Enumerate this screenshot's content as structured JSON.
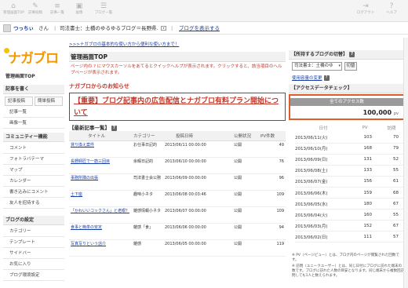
{
  "toolbar": {
    "items": [
      {
        "label": "管理画面TOP",
        "icon": "home-icon"
      },
      {
        "label": "記事投稿",
        "icon": "pencil-icon"
      },
      {
        "label": "記事一覧",
        "icon": "list-icon"
      },
      {
        "label": "画像",
        "icon": "image-icon"
      },
      {
        "label": "ブログー覧",
        "icon": "blog-icon"
      }
    ],
    "right_items": [
      {
        "label": "ログアウト",
        "icon": "logout-icon"
      },
      {
        "label": "ヘルプ",
        "icon": "help-icon"
      }
    ]
  },
  "userbar": {
    "username": "つっちぃ",
    "suffix": "さん",
    "separator": "|",
    "blog_name": "司法書士：土橋のゆるゆるブログ＝長野県…",
    "dropdown_caret": "▾",
    "show_blog": "ブログを表示する"
  },
  "sidebar": {
    "logo_text": "ナガブロ",
    "top_link": "管理画面TOP",
    "sections": [
      {
        "title": "記事を書く",
        "tabs": [
          "記事投稿",
          "簡単投稿"
        ],
        "items": [
          "記事一覧",
          "画像一覧"
        ]
      },
      {
        "title": "コミュニティー機能",
        "items": [
          "コメント",
          "フォトラバテーマ",
          "マップ",
          "カレンダー",
          "書き込みにコメント",
          "友人を招待する"
        ]
      },
      {
        "title": "ブログの設定",
        "items": [
          "カテゴリー",
          "テンプレート",
          "サイドバー",
          "お気に入り",
          "ブログ環境設定"
        ]
      }
    ]
  },
  "main": {
    "notice": ">>>ナガブロの基本的な使い方から便利な使い方まで！",
    "page_title": "管理画面TOP",
    "help_text": "ページ内の ? にマウスカーソルをあてるとクイックヘルプが表示されます。クリックすると、該当項目のヘルプページが表示されます。",
    "news_label": "ナガブロからのお知らせ",
    "announcement": "【重要】ブログ記事内の広告配信とナガブロ有料プラン開始について",
    "recent_label": "【最新記事一覧】",
    "help_mark": "?",
    "posts_headers": [
      "タイトル",
      "カテゴリー",
      "投稿日時",
      "公開状況",
      "PV件数"
    ],
    "posts": [
      {
        "title": "貸り換え案件",
        "category": "お仕事日記的",
        "date": "2013/06/11 00:00:00",
        "status": "公開",
        "pv": "49"
      },
      {
        "title": "長野師匠で一筋三回目",
        "category": "余暇日記的",
        "date": "2013/06/10 00:00:00",
        "status": "公開",
        "pv": "76"
      },
      {
        "title": "事務所隣の出張",
        "category": "司法書士会公務",
        "date": "2013/06/09 00:00:00",
        "status": "公開",
        "pv": "96"
      },
      {
        "title": "土下座",
        "category": "趣味小ネタ",
        "date": "2013/06/08 00:03:46",
        "status": "公開",
        "pv": "109"
      },
      {
        "title": "「かわいいコックさん」と老眼？",
        "category": "雑感情報小ネタ",
        "date": "2013/06/07 00:00:00",
        "status": "公開",
        "pv": "109"
      },
      {
        "title": "食事と簡単の安定",
        "category": "雑感「食」",
        "date": "2013/06/06 00:00:00",
        "status": "公開",
        "pv": "94"
      },
      {
        "title": "写真写りという話介",
        "category": "雑感",
        "date": "2013/06/05 00:00:00",
        "status": "公開",
        "pv": "119"
      }
    ]
  },
  "right": {
    "blog_switch_title": "【所持するブログの切替】",
    "help_mark": "?",
    "blog_select_value": "司法書士：土橋のゆ",
    "select_caret": "▾",
    "switch_button": "切替",
    "capacity_link": "使用容量の変更",
    "access_title": "【アクセスデータチェック】",
    "total_label": "全てのアクセス数",
    "total_value": "100,000",
    "total_unit": "pv",
    "stats_headers": [
      "日付",
      "PV",
      "訪問"
    ],
    "stats": [
      {
        "date": "2013/06/11(火)",
        "pv": "103",
        "visits": "70"
      },
      {
        "date": "2013/06/10(月)",
        "pv": "168",
        "visits": "79"
      },
      {
        "date": "2013/06/09(日)",
        "pv": "131",
        "visits": "52"
      },
      {
        "date": "2013/06/08(土)",
        "pv": "133",
        "visits": "55"
      },
      {
        "date": "2013/06/07(金)",
        "pv": "156",
        "visits": "61"
      },
      {
        "date": "2013/06/06(木)",
        "pv": "159",
        "visits": "68"
      },
      {
        "date": "2013/06/05(水)",
        "pv": "180",
        "visits": "67"
      },
      {
        "date": "2013/06/04(火)",
        "pv": "160",
        "visits": "55"
      },
      {
        "date": "2013/06/03(月)",
        "pv": "152",
        "visits": "67"
      },
      {
        "date": "2013/06/02(日)",
        "pv": "111",
        "visits": "57"
      }
    ],
    "footnote_pv": "※ PV（ページビュー）とは、ブログ内のページが閲覧された回数です。",
    "footnote_visit": "※ 訪問（ユニークユーザー）とは、同じ日付にブログに訪れた端末の数です。ブログに訪れた人数の目安となります。同じ端末から複数回訪問しても1人と数えられます。"
  }
}
